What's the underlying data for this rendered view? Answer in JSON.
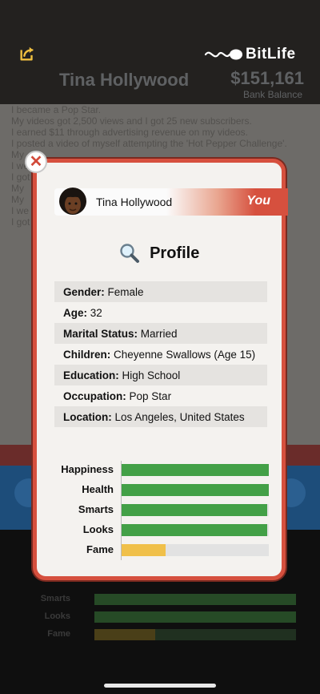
{
  "app": {
    "logo_text": "BitLife",
    "accent": "#d6503e"
  },
  "background": {
    "character_name": "Tina Hollywood",
    "bank_balance": "$151,161",
    "bank_label": "Bank Balance",
    "log_lines": [
      "I became a Pop Star.",
      "My videos got 2,500 views and I got 25 new subscribers.",
      "I earned $11 through advertising revenue on my videos.",
      "I posted a video of myself attempting the 'Hot Pepper Challenge'.",
      "My",
      "I we",
      "I got",
      "My",
      "My",
      "I we",
      "I got"
    ],
    "stats_visible": [
      "Smarts",
      "Looks",
      "Fame"
    ]
  },
  "modal": {
    "person_name": "Tina Hollywood",
    "you_label": "You",
    "title": "Profile",
    "close_icon": "close-icon",
    "info": [
      {
        "label": "Gender:",
        "value": "Female"
      },
      {
        "label": "Age:",
        "value": "32"
      },
      {
        "label": "Marital Status:",
        "value": "Married"
      },
      {
        "label": "Children:",
        "value": "Cheyenne Swallows (Age 15)"
      },
      {
        "label": "Education:",
        "value": "High School"
      },
      {
        "label": "Occupation:",
        "value": "Pop Star"
      },
      {
        "label": "Location:",
        "value": "Los Angeles, United States"
      }
    ],
    "stats": [
      {
        "label": "Happiness",
        "value": 1.0,
        "color": "#43a047"
      },
      {
        "label": "Health",
        "value": 1.0,
        "color": "#43a047"
      },
      {
        "label": "Smarts",
        "value": 0.99,
        "color": "#43a047"
      },
      {
        "label": "Looks",
        "value": 0.99,
        "color": "#43a047"
      },
      {
        "label": "Fame",
        "value": 0.3,
        "color": "#f0c04a"
      }
    ]
  }
}
